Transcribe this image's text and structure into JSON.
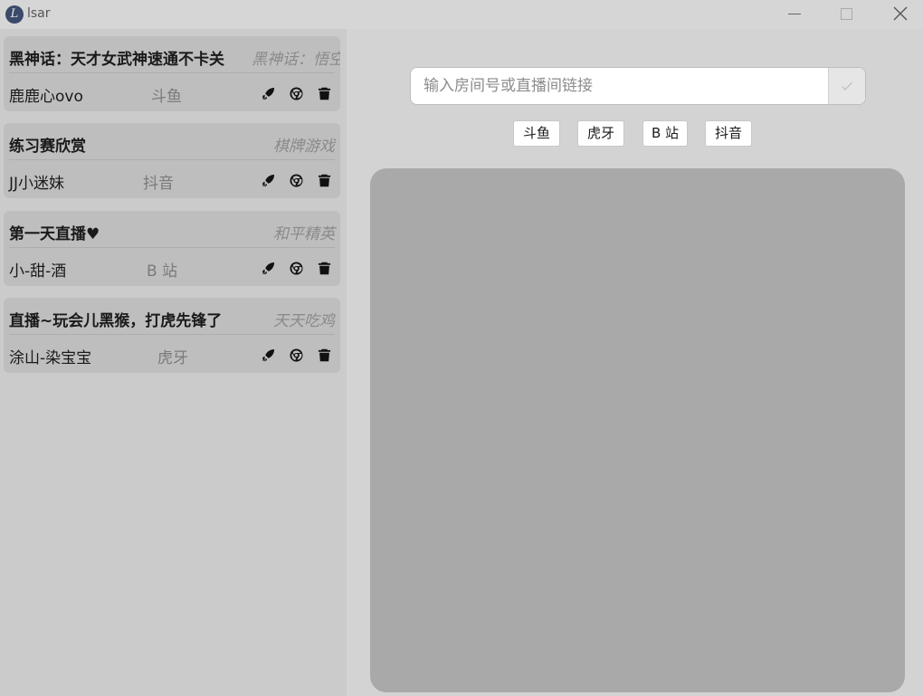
{
  "window": {
    "title": "lsar",
    "logo_letter": "L"
  },
  "sidebar": {
    "cards": [
      {
        "title": "黑神话：天才女武神速通不卡关",
        "category": "黑神话：悟空",
        "streamer": "鹿鹿心ovo",
        "platform": "斗鱼"
      },
      {
        "title": "练习赛欣赏",
        "category": "棋牌游戏",
        "streamer": "JJ小迷妹",
        "platform": "抖音"
      },
      {
        "title": "第一天直播♥",
        "category": "和平精英",
        "streamer": "小-甜-酒",
        "platform": "B 站"
      },
      {
        "title": "直播~玩会儿黑猴，打虎先锋了",
        "category": "天天吃鸡",
        "streamer": "涂山-染宝宝",
        "platform": "虎牙"
      }
    ],
    "action_icons": [
      "rocket-icon",
      "chrome-icon",
      "trash-icon"
    ]
  },
  "main": {
    "search_placeholder": "输入房间号或直播间链接",
    "submit_icon": "check-icon",
    "platforms": [
      "斗鱼",
      "虎牙",
      "B 站",
      "抖音"
    ]
  },
  "colors": {
    "sidebar_bg": "#cbcbcb",
    "card_bg": "#bebebe",
    "player_bg": "#a9a9a9",
    "main_bg": "#d3d3d3"
  }
}
